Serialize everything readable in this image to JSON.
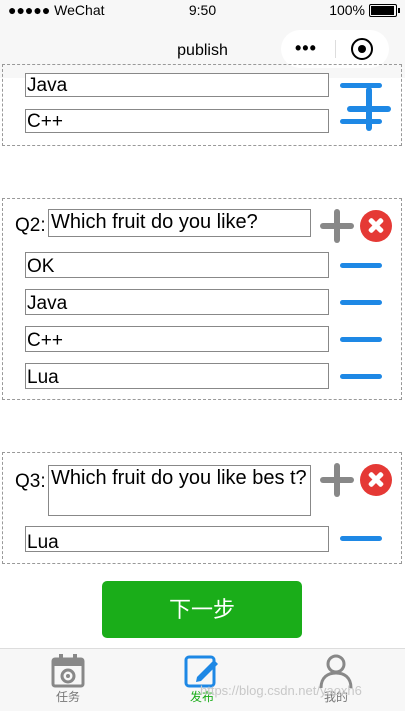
{
  "status_bar": {
    "carrier": "●●●●● WeChat",
    "time": "9:50",
    "battery": "100%"
  },
  "nav": {
    "title": "publish",
    "menu_icon": "•••",
    "target_icon": "record-icon"
  },
  "questions": [
    {
      "options": [
        "Java",
        "C++"
      ]
    },
    {
      "label": "Q2:",
      "text": "Which fruit do you like?",
      "options": [
        "OK",
        "Java",
        "C++",
        "Lua"
      ]
    },
    {
      "label": "Q3:",
      "text": "Which fruit do you like bes t?",
      "options": [
        "Lua"
      ]
    }
  ],
  "next_button": "下一步",
  "tabs": [
    {
      "label": "任务",
      "icon": "calendar-gear-icon"
    },
    {
      "label": "发布",
      "icon": "edit-icon"
    },
    {
      "label": "我的",
      "icon": "user-icon"
    }
  ],
  "watermark": "https://blog.csdn.net/yaoxh6",
  "colors": {
    "accent_blue": "#1e88e5",
    "brand_green": "#1aad19",
    "delete_red": "#e53935"
  }
}
